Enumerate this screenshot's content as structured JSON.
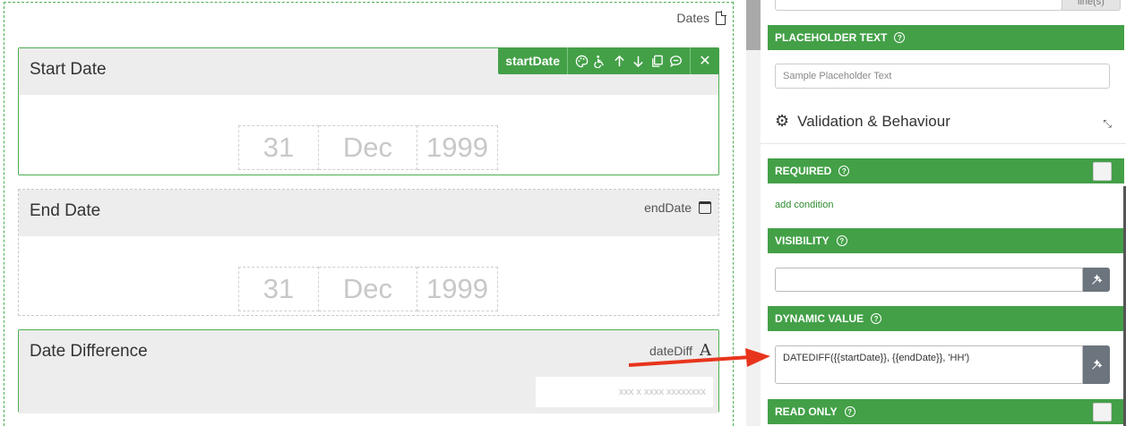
{
  "canvas": {
    "group_label": "Dates",
    "fields": {
      "start": {
        "title": "Start Date",
        "key": "startDate",
        "day": "31",
        "month": "Dec",
        "year": "1999"
      },
      "end": {
        "title": "End Date",
        "key": "endDate",
        "day": "31",
        "month": "Dec",
        "year": "1999"
      },
      "diff": {
        "title": "Date Difference",
        "key": "dateDiff",
        "placeholder": "xxx x xxxx xxxxxxxx"
      }
    },
    "toolbar": {
      "key": "startDate",
      "icons": [
        "palette-icon",
        "accessibility-icon",
        "arrow-up-icon",
        "arrow-down-icon",
        "copy-icon",
        "comment-icon"
      ],
      "close_label": "✕"
    }
  },
  "panel": {
    "top_addon": "line(s)",
    "placeholder_section": {
      "label": "PLACEHOLDER TEXT",
      "value": "Sample Placeholder Text"
    },
    "validation_title": "Validation & Behaviour",
    "required": {
      "label": "REQUIRED",
      "link": "add condition"
    },
    "visibility": {
      "label": "VISIBILITY",
      "value": ""
    },
    "dynamic_value": {
      "label": "DYNAMIC VALUE",
      "value": "DATEDIFF({{startDate}}, {{endDate}}, 'HH')"
    },
    "read_only": {
      "label": "READ ONLY"
    }
  },
  "colors": {
    "accent": "#43a047",
    "field_header": "#ededed",
    "button_gray": "#6c757d",
    "arrow": "#e8341c"
  }
}
